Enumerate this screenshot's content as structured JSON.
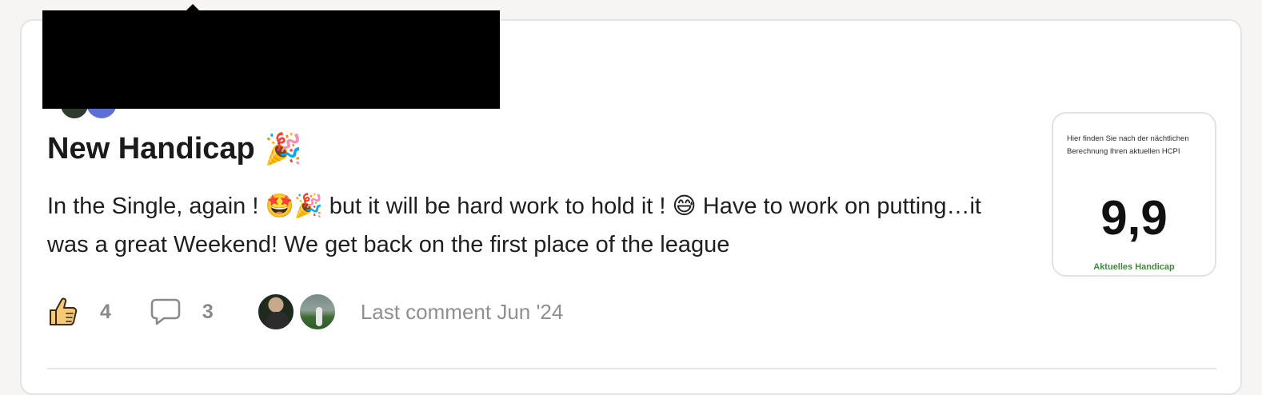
{
  "post": {
    "title": "New Handicap",
    "title_emoji": "🎉",
    "body": "In the Single, again ! 🤩🎉 but it will be hard work to hold it ! 😅 Have to work on putting…it was a great Weekend! We get back on the first place of the league"
  },
  "footer": {
    "likes": "4",
    "comments": "3",
    "last_comment": "Last comment Jun '24",
    "like_icon": "thumbs-up-icon",
    "comment_icon": "speech-bubble-icon"
  },
  "handicap_card": {
    "description": "Hier finden Sie nach der nächtlichen Berechnung Ihren aktuellen HCPI",
    "value": "9,9",
    "label": "Aktuelles Handicap",
    "label_color": "#3c8a3a"
  }
}
